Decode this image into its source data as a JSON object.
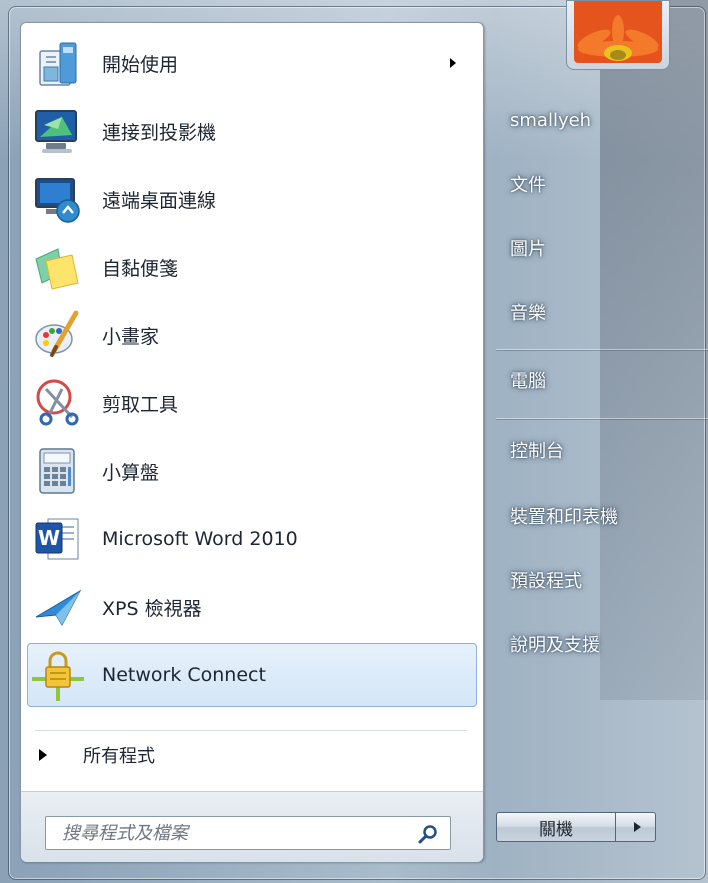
{
  "start_menu": {
    "programs": [
      {
        "label": "開始使用",
        "icon": "getting-started-icon",
        "has_submenu": true,
        "selected": false
      },
      {
        "label": "連接到投影機",
        "icon": "projector-icon",
        "has_submenu": false,
        "selected": false
      },
      {
        "label": "遠端桌面連線",
        "icon": "remote-desktop-icon",
        "has_submenu": false,
        "selected": false
      },
      {
        "label": "自黏便箋",
        "icon": "sticky-notes-icon",
        "has_submenu": false,
        "selected": false
      },
      {
        "label": "小畫家",
        "icon": "paint-icon",
        "has_submenu": false,
        "selected": false
      },
      {
        "label": "剪取工具",
        "icon": "snipping-tool-icon",
        "has_submenu": false,
        "selected": false
      },
      {
        "label": "小算盤",
        "icon": "calculator-icon",
        "has_submenu": false,
        "selected": false
      },
      {
        "label": "Microsoft Word 2010",
        "icon": "word-icon",
        "has_submenu": false,
        "selected": false
      },
      {
        "label": "XPS 檢視器",
        "icon": "xps-viewer-icon",
        "has_submenu": false,
        "selected": false
      },
      {
        "label": "Network Connect",
        "icon": "network-connect-lock-icon",
        "has_submenu": false,
        "selected": true
      }
    ],
    "all_programs_label": "所有程式",
    "search": {
      "placeholder": "搜尋程式及檔案",
      "value": ""
    },
    "user": {
      "name": "smallyeh",
      "avatar": "flower-avatar"
    },
    "right_items": [
      {
        "label": "smallyeh"
      },
      {
        "label": "文件"
      },
      {
        "label": "圖片"
      },
      {
        "label": "音樂"
      },
      {
        "label": "電腦"
      },
      {
        "label": "控制台"
      },
      {
        "label": "裝置和印表機"
      },
      {
        "label": "預設程式"
      },
      {
        "label": "說明及支援"
      }
    ],
    "shutdown_label": "關機",
    "colors": {
      "selected_bg": "#dbeaf8",
      "selected_border": "#8fb2d6",
      "right_text": "#ffffff"
    }
  }
}
